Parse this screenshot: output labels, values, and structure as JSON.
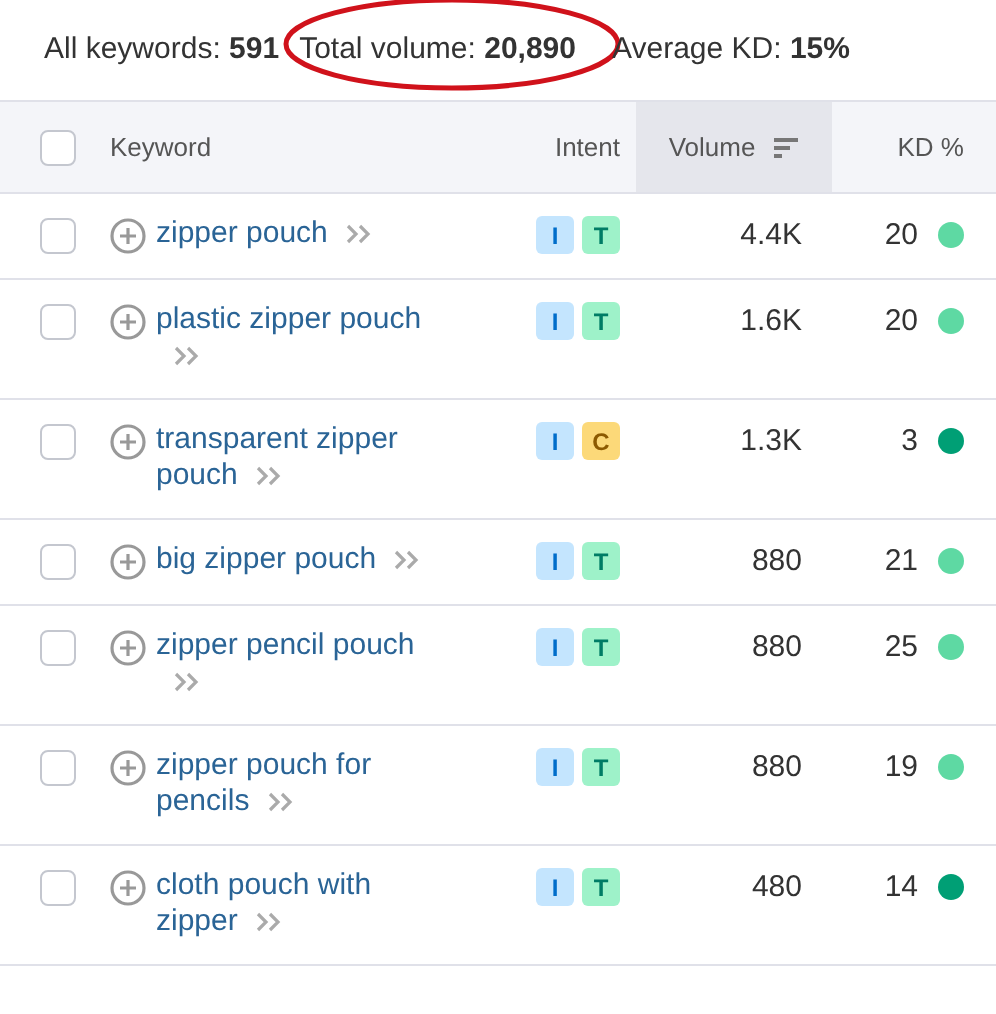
{
  "summary": [
    {
      "label": "All keywords:",
      "value": "591",
      "highlighted": false
    },
    {
      "label": "Total volume:",
      "value": "20,890",
      "highlighted": true
    },
    {
      "label": "Average KD:",
      "value": "15%",
      "highlighted": false
    }
  ],
  "table": {
    "select_all": {
      "checked": false
    },
    "columns": [
      {
        "label": "Keyword",
        "sorted": false
      },
      {
        "label": "Intent",
        "sorted": false
      },
      {
        "label": "Volume",
        "sorted": true
      },
      {
        "label": "KD %",
        "sorted": false
      }
    ],
    "rows": [
      {
        "checked": false,
        "keyword": "zipper pouch",
        "intent": [
          {
            "label": "I",
            "kind": "informational"
          },
          {
            "label": "T",
            "kind": "transactional"
          }
        ],
        "volume": "4.4K",
        "kd": "20",
        "color": "#5ed9a3"
      },
      {
        "checked": false,
        "keyword": "plastic zipper pouch",
        "intent": [
          {
            "label": "I",
            "kind": "informational"
          },
          {
            "label": "T",
            "kind": "transactional"
          }
        ],
        "volume": "1.6K",
        "kd": "20",
        "color": "#5ed9a3"
      },
      {
        "checked": false,
        "keyword": "transparent zipper pouch",
        "intent": [
          {
            "label": "I",
            "kind": "informational"
          },
          {
            "label": "C",
            "kind": "commercial"
          }
        ],
        "volume": "1.3K",
        "kd": "3",
        "color": "#009f75"
      },
      {
        "checked": false,
        "keyword": "big zipper pouch",
        "intent": [
          {
            "label": "I",
            "kind": "informational"
          },
          {
            "label": "T",
            "kind": "transactional"
          }
        ],
        "volume": "880",
        "kd": "21",
        "color": "#5ed9a3"
      },
      {
        "checked": false,
        "keyword": "zipper pencil pouch",
        "intent": [
          {
            "label": "I",
            "kind": "informational"
          },
          {
            "label": "T",
            "kind": "transactional"
          }
        ],
        "volume": "880",
        "kd": "25",
        "color": "#5ed9a3"
      },
      {
        "checked": false,
        "keyword": "zipper pouch for pencils",
        "intent": [
          {
            "label": "I",
            "kind": "informational"
          },
          {
            "label": "T",
            "kind": "transactional"
          }
        ],
        "volume": "880",
        "kd": "19",
        "color": "#5ed9a3"
      },
      {
        "checked": false,
        "keyword": "cloth pouch with zipper",
        "intent": [
          {
            "label": "I",
            "kind": "informational"
          },
          {
            "label": "T",
            "kind": "transactional"
          }
        ],
        "volume": "480",
        "kd": "14",
        "color": "#009f75"
      }
    ]
  }
}
